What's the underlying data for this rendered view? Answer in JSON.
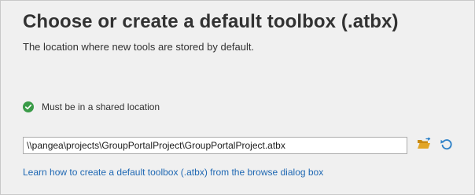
{
  "header": {
    "title": "Choose or create a default toolbox (.atbx)",
    "subtitle": "The location where new tools are stored by default."
  },
  "status": {
    "icon": "check-circle-icon",
    "text": "Must be in a shared location",
    "color": "#3a9b48"
  },
  "path_field": {
    "value": "\\\\pangea\\projects\\GroupPortalProject\\GroupPortalProject.atbx"
  },
  "actions": {
    "browse_icon": "folder-open-icon",
    "reset_icon": "reset-icon"
  },
  "help": {
    "link_text": "Learn how to create a default toolbox (.atbx) from the browse dialog box"
  },
  "colors": {
    "background": "#f0f0f0",
    "link": "#1f68b3",
    "folder": "#e2a526",
    "accent_blue": "#2f82c8"
  }
}
